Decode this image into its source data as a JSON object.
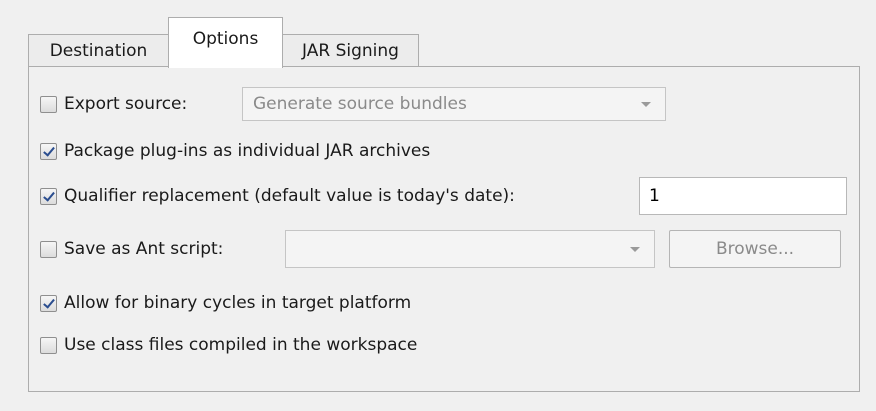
{
  "tabs": [
    {
      "label": "Destination",
      "active": false
    },
    {
      "label": "Options",
      "active": true
    },
    {
      "label": "JAR Signing",
      "active": false
    }
  ],
  "options": {
    "export_source": {
      "label": "Export source:",
      "checked": false,
      "combo_value": "Generate source bundles",
      "combo_enabled": false
    },
    "package_plugins": {
      "label": "Package plug-ins as individual JAR archives",
      "checked": true
    },
    "qualifier": {
      "label": "Qualifier replacement (default value is today's date):",
      "checked": true,
      "value": "1"
    },
    "ant_script": {
      "label": "Save as Ant script:",
      "checked": false,
      "combo_value": "",
      "browse_label": "Browse...",
      "enabled": false
    },
    "binary_cycles": {
      "label": "Allow for binary cycles in target platform",
      "checked": true
    },
    "class_files": {
      "label": "Use class files compiled in the workspace",
      "checked": false
    }
  },
  "colors": {
    "checkmark": "#2a4d8f",
    "background": "#f0f0f0",
    "border": "#adadad"
  }
}
